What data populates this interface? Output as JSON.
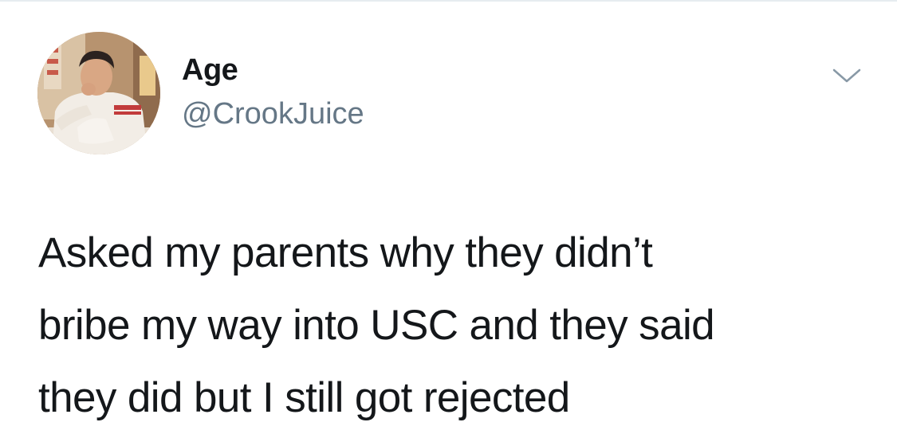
{
  "author": {
    "display_name": "Age",
    "handle": "@CrookJuice",
    "avatar_icon": "profile-photo"
  },
  "menu": {
    "icon": "chevron-down-icon"
  },
  "tweet": {
    "lines": [
      "Asked my parents why they didn’t",
      "bribe my way into USC and they said",
      "they did but I still got rejected"
    ]
  },
  "colors": {
    "text": "#14171a",
    "secondary": "#657786",
    "divider": "#e6ecf0",
    "background": "#ffffff"
  }
}
